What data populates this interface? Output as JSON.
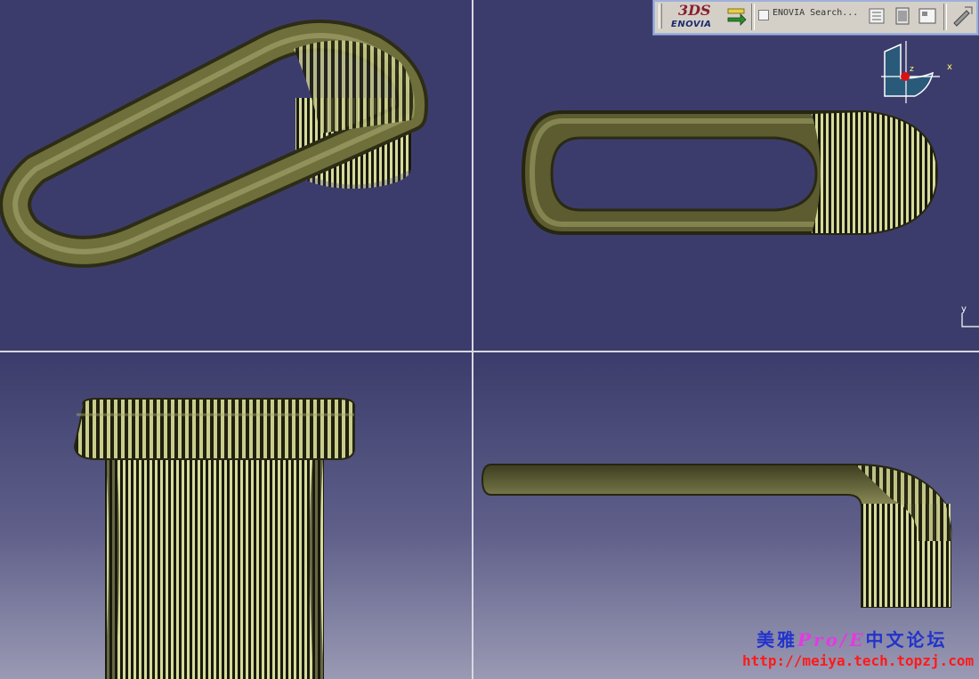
{
  "toolbar": {
    "logo_ds": "3DS",
    "logo_text": "ENOVIA",
    "search_label": "ENOVIA Search...",
    "icons": [
      "enovia-logo-icon",
      "send-to-icon",
      "search-checkbox-icon",
      "properties-icon",
      "document-icon",
      "frame-icon",
      "wand-icon"
    ]
  },
  "compass": {
    "axis_z": "z",
    "axis_x": "x"
  },
  "axis_indicator": {
    "axis_y": "y"
  },
  "watermark": {
    "line1_pre": "美雅",
    "line1_proe": "Pro/E",
    "line1_post": "中文论坛",
    "line2": "http://meiya.tech.topzj.com"
  },
  "colors": {
    "background": "#3c3c6c",
    "model_olive": "#6b6b3a",
    "stripe_light": "#d8dca0",
    "stripe_dark": "#141408"
  }
}
